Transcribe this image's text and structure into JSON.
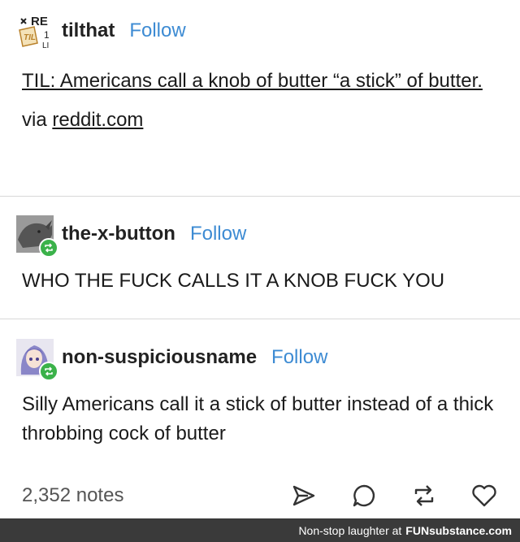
{
  "posts": [
    {
      "username": "tilthat",
      "follow_label": "Follow",
      "avatar_label": "TIL",
      "title_link": "TIL: Americans call a knob of butter “a stick” of butter.",
      "via_prefix": "via",
      "via_link": "reddit.com"
    },
    {
      "username": "the-x-button",
      "follow_label": "Follow",
      "text": "WHO THE FUCK CALLS IT A KNOB FUCK YOU"
    },
    {
      "username": "non-suspiciousname",
      "follow_label": "Follow",
      "text": "Silly Americans call it a stick of butter instead of a thick throbbing cock of butter"
    }
  ],
  "footer": {
    "notes": "2,352 notes",
    "icons": [
      "share-icon",
      "reply-icon",
      "reblog-icon",
      "like-icon"
    ]
  },
  "watermark": {
    "text": "Non-stop laughter at",
    "brand": "FUNsubstance.com"
  },
  "colors": {
    "follow": "#3d8bd3",
    "reblog_badge": "#3bb24a",
    "watermark_bg": "#3a3a3a",
    "divider": "#d8d8d8"
  }
}
